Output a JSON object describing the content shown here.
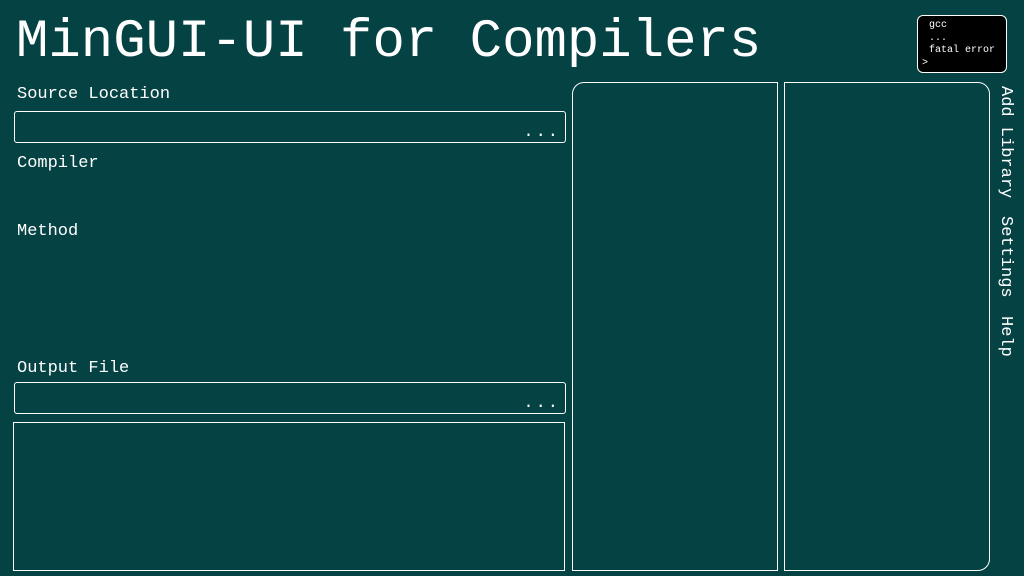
{
  "app": {
    "title": "MinGUI-UI for Compilers"
  },
  "logo": {
    "lines": [
      "gcc",
      "...",
      "fatal error",
      ">"
    ]
  },
  "form": {
    "source_label": "Source Location",
    "source_value": "",
    "browse_label": "...",
    "compiler_label": "Compiler",
    "method_label": "Method",
    "output_label": "Output File",
    "output_value": "",
    "output_browse_label": "..."
  },
  "side_nav": {
    "items": [
      "Add Library",
      "Settings",
      "Help"
    ]
  },
  "colors": {
    "background": "#054244",
    "foreground": "#ffffff",
    "logo_bg": "#000000"
  }
}
